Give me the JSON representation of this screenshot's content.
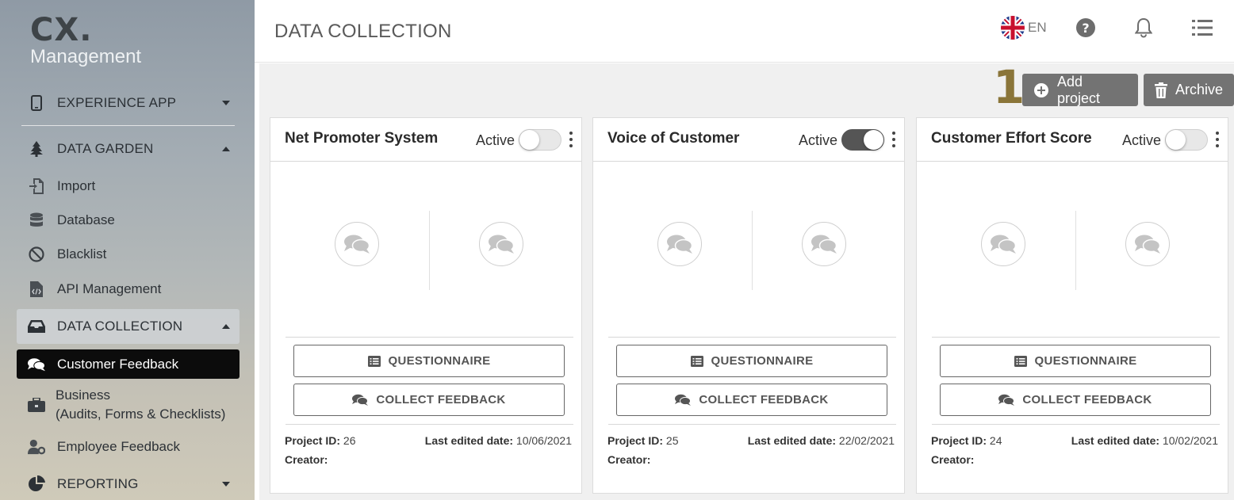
{
  "brand": {
    "logo_main": "CX.",
    "logo_sub": "Management"
  },
  "sidebar": {
    "items": [
      {
        "label": "EXPERIENCE APP"
      },
      {
        "label": "DATA GARDEN"
      },
      {
        "label": "Import"
      },
      {
        "label": "Database"
      },
      {
        "label": "Blacklist"
      },
      {
        "label": "API Management"
      },
      {
        "label": "DATA COLLECTION"
      },
      {
        "label": "Customer Feedback"
      },
      {
        "label": "Business"
      },
      {
        "label": "(Audits, Forms & Checklists)"
      },
      {
        "label": "Employee Feedback"
      },
      {
        "label": "REPORTING"
      }
    ]
  },
  "header": {
    "title": "DATA COLLECTION",
    "language": "EN"
  },
  "toolbar": {
    "step_number": "1",
    "add_project_label": "Add project",
    "archive_label": "Archive"
  },
  "cards": [
    {
      "title": "Net Promoter System",
      "active_label": "Active",
      "active": false,
      "questionnaire_label": "QUESTIONNAIRE",
      "collect_label": "COLLECT FEEDBACK",
      "project_id_label": "Project ID:",
      "project_id": "26",
      "last_edited_label": "Last edited date:",
      "last_edited": "10/06/2021",
      "creator_label": "Creator:"
    },
    {
      "title": "Voice of Customer",
      "active_label": "Active",
      "active": true,
      "questionnaire_label": "QUESTIONNAIRE",
      "collect_label": "COLLECT FEEDBACK",
      "project_id_label": "Project ID:",
      "project_id": "25",
      "last_edited_label": "Last edited date:",
      "last_edited": "22/02/2021",
      "creator_label": "Creator:"
    },
    {
      "title": "Customer Effort Score",
      "active_label": "Active",
      "active": false,
      "questionnaire_label": "QUESTIONNAIRE",
      "collect_label": "COLLECT FEEDBACK",
      "project_id_label": "Project ID:",
      "project_id": "24",
      "last_edited_label": "Last edited date:",
      "last_edited": "10/02/2021",
      "creator_label": "Creator:"
    }
  ],
  "colors": {
    "accent_number": "#8a7539",
    "toolbar_button": "#737373",
    "active_nav": "#0c0c0c"
  }
}
